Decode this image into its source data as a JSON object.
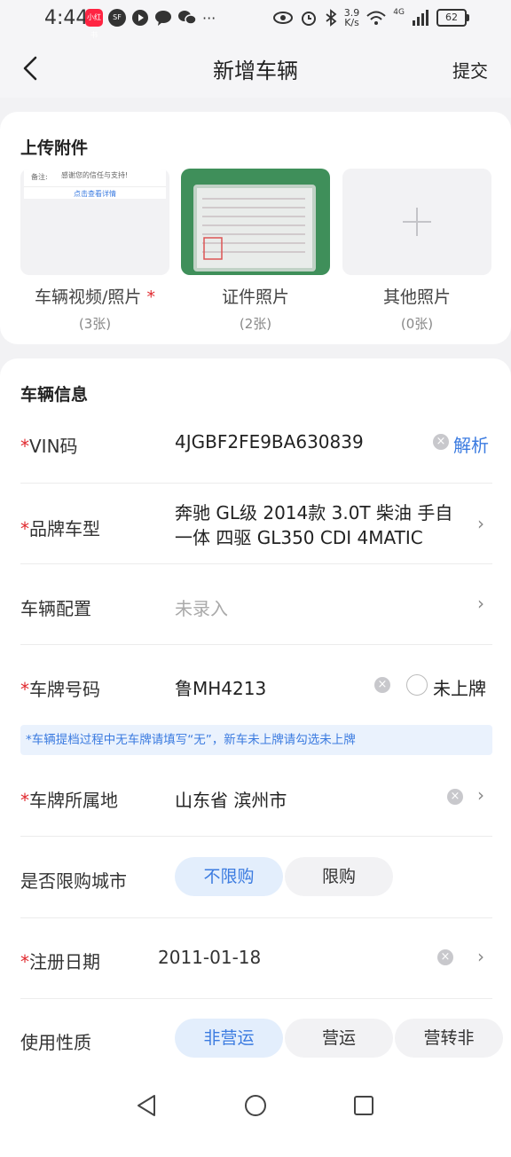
{
  "status_bar": {
    "time": "4:44",
    "net_speed_value": "3.9",
    "net_speed_unit": "K/s",
    "network_type": "4G",
    "battery": "62",
    "app_badge_text": "小红书",
    "sf_badge_text": "SF",
    "more": "···"
  },
  "header": {
    "title": "新增车辆",
    "submit_label": "提交"
  },
  "attachments": {
    "section_title": "上传附件",
    "items": [
      {
        "label": "车辆视频/照片",
        "required_mark": "*",
        "count": "(3张)",
        "preview_text_1": "备注:",
        "preview_text_2": "感谢您的信任与支持!",
        "preview_link": "点击查看详情"
      },
      {
        "label": "证件照片",
        "count": "(2张)"
      },
      {
        "label": "其他照片",
        "count": "(0张)"
      }
    ]
  },
  "vehicle_info": {
    "section_title": "车辆信息",
    "vin": {
      "label": "VIN码",
      "value": "4JGBF2FE9BA630839",
      "action": "解析"
    },
    "model": {
      "label": "品牌车型",
      "line1": "奔驰 GL级 2014款 3.0T 柴油 手自",
      "line2": "一体 四驱 GL350 CDI 4MATIC"
    },
    "config": {
      "label": "车辆配置",
      "placeholder": "未录入"
    },
    "plate": {
      "label": "车牌号码",
      "value": "鲁MH4213",
      "no_plate_label": "未上牌"
    },
    "plate_hint": "*车辆提档过程中无车牌请填写“无”，新车未上牌请勾选未上牌",
    "plate_region": {
      "label": "车牌所属地",
      "value": "山东省 滨州市"
    },
    "purchase_limit": {
      "label": "是否限购城市",
      "options": [
        "不限购",
        "限购"
      ],
      "selected": "不限购"
    },
    "register_date": {
      "label": "注册日期",
      "value": "2011-01-18"
    },
    "usage": {
      "label": "使用性质",
      "options": [
        "非营运",
        "营运",
        "营转非"
      ],
      "selected": "非营运"
    }
  },
  "required_mark": "*"
}
